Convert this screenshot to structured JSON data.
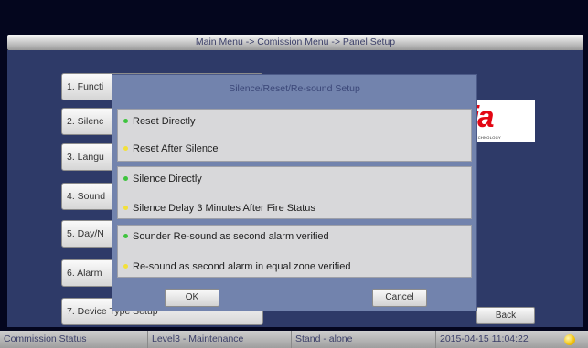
{
  "header": {
    "breadcrumb": "Main Menu -> Comission Menu -> Panel Setup"
  },
  "menu": {
    "items": [
      {
        "label": "1. Functi"
      },
      {
        "label": "2. Silenc"
      },
      {
        "label": "3. Langu"
      },
      {
        "label": "4. Sound"
      },
      {
        "label": "5. Day/N"
      },
      {
        "label": "6. Alarm"
      },
      {
        "label": "7. Device Type Setup"
      }
    ]
  },
  "logo": {
    "mark": "ia",
    "tagline": "TECHNOLOGY"
  },
  "back_label": "Back",
  "dialog": {
    "title": "Silence/Reset/Re-sound Setup",
    "groups": [
      {
        "options": [
          {
            "label": "Reset Directly",
            "indicator": "green"
          },
          {
            "label": "Reset After Silence",
            "indicator": "yellow"
          }
        ]
      },
      {
        "options": [
          {
            "label": "Silence Directly",
            "indicator": "green"
          },
          {
            "label": "Silence Delay 3 Minutes After Fire Status",
            "indicator": "yellow"
          }
        ]
      },
      {
        "options": [
          {
            "label": "Sounder Re-sound as second alarm verified",
            "indicator": "green"
          },
          {
            "label": "Re-sound as second alarm in equal zone verified",
            "indicator": "yellow"
          }
        ]
      }
    ],
    "ok_label": "OK",
    "cancel_label": "Cancel"
  },
  "status": {
    "mode": "Commission Status",
    "level": "Level3 - Maintenance",
    "network": "Stand - alone",
    "datetime": "2015-04-15 11:04:22"
  },
  "colors": {
    "selected": "#3ec43e",
    "unselected": "#f2e03a",
    "brand": "#e30613"
  }
}
